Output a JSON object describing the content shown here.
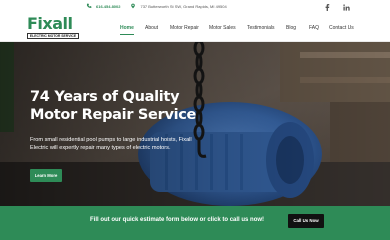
{
  "topbar": {
    "phone": "616.454.8002",
    "address": "737 Butterworth St SW, Grand Rapids, MI 49504",
    "social": {
      "facebook_icon": "facebook-icon",
      "linkedin_icon": "linkedin-icon"
    },
    "icons": {
      "phone": "phone-icon",
      "location": "map-pin-icon"
    }
  },
  "header": {
    "logo_text": "Fixall",
    "logo_tag": "ELECTRIC MOTOR SERVICE",
    "nav": [
      {
        "label": "Home",
        "active": true
      },
      {
        "label": "About",
        "active": false
      },
      {
        "label": "Motor Repair",
        "active": false
      },
      {
        "label": "Motor Sales",
        "active": false
      },
      {
        "label": "Testimonials",
        "active": false
      },
      {
        "label": "Blog",
        "active": false
      },
      {
        "label": "FAQ",
        "active": false
      },
      {
        "label": "Contact Us",
        "active": false
      }
    ]
  },
  "hero": {
    "title_line1": "74 Years of Quality",
    "title_line2": "Motor Repair Service",
    "description": "From small residential pool pumps to large industrial hoists, Fixall Electric will expertly repair many types of electric motors.",
    "button_label": "Learn More"
  },
  "cta": {
    "message": "Fill out our quick estimate form below or click to call us now!",
    "button_label": "Call Us Now"
  },
  "colors": {
    "accent": "#2e8b57",
    "dark": "#111111",
    "motor_blue": "#3d6fb6"
  }
}
